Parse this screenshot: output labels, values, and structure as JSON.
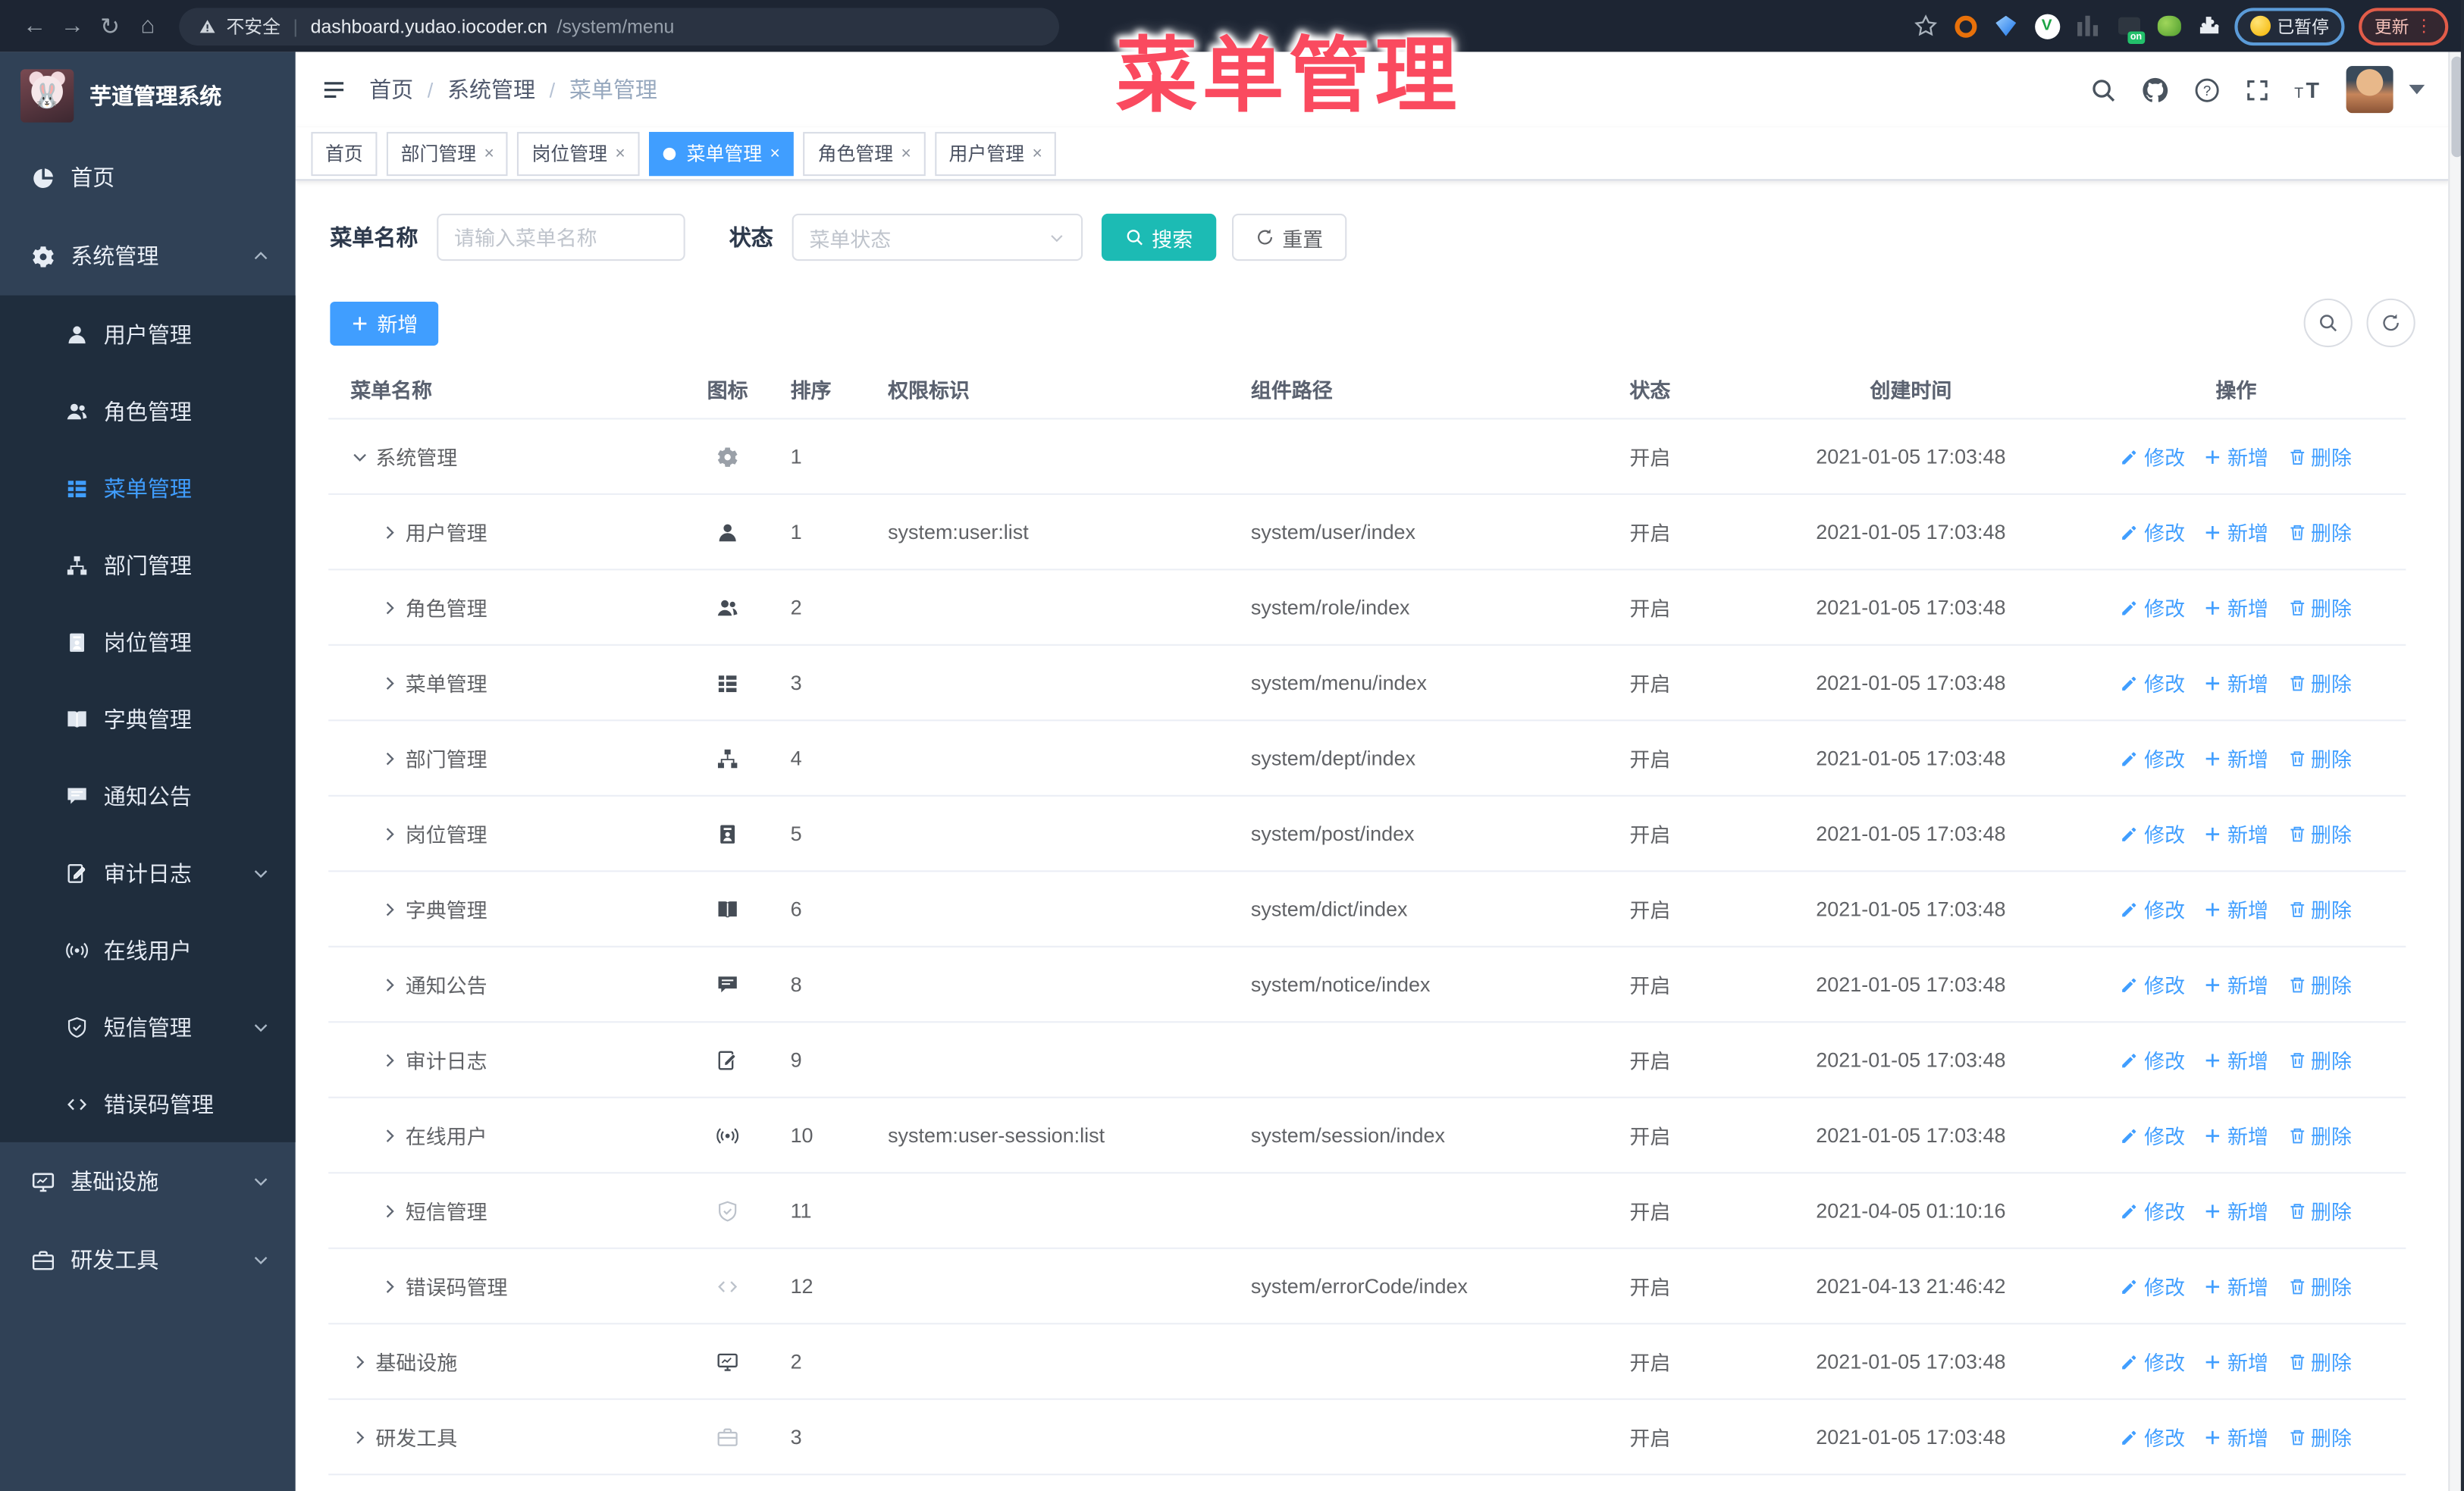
{
  "colors": {
    "accent": "#409eff",
    "teal": "#1cbbb4",
    "overlay": "#fa4a5f",
    "sidebar_bg": "#304156",
    "submenu_bg": "#1f2d3d",
    "chrome_bg": "#1d2533"
  },
  "overlay_title": "菜单管理",
  "browser": {
    "security_label": "不安全",
    "url_domain": "dashboard.yudao.iocoder.cn",
    "url_path": "/system/menu",
    "nav_icons": [
      "back",
      "forward",
      "reload",
      "home"
    ],
    "extension_icons": [
      "bookmark-star",
      "ext-ring",
      "ext-gem",
      "ext-check",
      "ext-columns",
      "ext-tag-on",
      "ext-frog",
      "ext-puzzle"
    ],
    "paused_badge": "已暂停",
    "update_button": "更新",
    "kebab": "⋮"
  },
  "sidebar": {
    "logo_title": "芋道管理系统",
    "items": [
      {
        "icon": "dashboard",
        "label": "首页"
      },
      {
        "icon": "gear",
        "label": "系统管理",
        "arrow": "up",
        "children": [
          {
            "icon": "user",
            "label": "用户管理"
          },
          {
            "icon": "users",
            "label": "角色管理"
          },
          {
            "icon": "tree",
            "label": "菜单管理",
            "active": true
          },
          {
            "icon": "org",
            "label": "部门管理"
          },
          {
            "icon": "badge",
            "label": "岗位管理"
          },
          {
            "icon": "book",
            "label": "字典管理"
          },
          {
            "icon": "chat",
            "label": "通知公告"
          },
          {
            "icon": "edit",
            "label": "审计日志",
            "arrow": "down"
          },
          {
            "icon": "signal",
            "label": "在线用户"
          },
          {
            "icon": "shield",
            "label": "短信管理",
            "arrow": "down"
          },
          {
            "icon": "code",
            "label": "错误码管理"
          }
        ]
      },
      {
        "icon": "monitor",
        "label": "基础设施",
        "arrow": "down"
      },
      {
        "icon": "briefcase",
        "label": "研发工具",
        "arrow": "down"
      }
    ]
  },
  "header": {
    "breadcrumb": [
      "首页",
      "系统管理",
      "菜单管理"
    ],
    "right_icons": [
      "search",
      "github",
      "question",
      "fullscreen",
      "fontsize",
      "avatar",
      "caret-down"
    ]
  },
  "tabs": [
    {
      "label": "首页",
      "closable": false,
      "active": false
    },
    {
      "label": "部门管理",
      "closable": true,
      "active": false
    },
    {
      "label": "岗位管理",
      "closable": true,
      "active": false
    },
    {
      "label": "菜单管理",
      "closable": true,
      "active": true
    },
    {
      "label": "角色管理",
      "closable": true,
      "active": false
    },
    {
      "label": "用户管理",
      "closable": true,
      "active": false
    }
  ],
  "filters": {
    "name_label": "菜单名称",
    "name_placeholder": "请输入菜单名称",
    "name_value": "",
    "status_label": "状态",
    "status_placeholder": "菜单状态",
    "search_label": "搜索",
    "reset_label": "重置"
  },
  "toolbar": {
    "add_label": "新增"
  },
  "table": {
    "columns": [
      "菜单名称",
      "图标",
      "排序",
      "权限标识",
      "组件路径",
      "状态",
      "创建时间",
      "操作"
    ],
    "op_labels": {
      "edit": "修改",
      "add": "新增",
      "delete": "删除"
    },
    "rows": [
      {
        "name": "系统管理",
        "caret": "down",
        "child": false,
        "icon": "gear",
        "tone": "mid",
        "sort": "1",
        "perm": "",
        "path": "",
        "status": "开启",
        "time": "2021-01-05 17:03:48"
      },
      {
        "name": "用户管理",
        "caret": "right",
        "child": true,
        "icon": "user",
        "tone": "dark",
        "sort": "1",
        "perm": "system:user:list",
        "path": "system/user/index",
        "status": "开启",
        "time": "2021-01-05 17:03:48"
      },
      {
        "name": "角色管理",
        "caret": "right",
        "child": true,
        "icon": "users",
        "tone": "dark",
        "sort": "2",
        "perm": "",
        "path": "system/role/index",
        "status": "开启",
        "time": "2021-01-05 17:03:48"
      },
      {
        "name": "菜单管理",
        "caret": "right",
        "child": true,
        "icon": "tree",
        "tone": "dark",
        "sort": "3",
        "perm": "",
        "path": "system/menu/index",
        "status": "开启",
        "time": "2021-01-05 17:03:48"
      },
      {
        "name": "部门管理",
        "caret": "right",
        "child": true,
        "icon": "org",
        "tone": "dark",
        "sort": "4",
        "perm": "",
        "path": "system/dept/index",
        "status": "开启",
        "time": "2021-01-05 17:03:48"
      },
      {
        "name": "岗位管理",
        "caret": "right",
        "child": true,
        "icon": "badge",
        "tone": "dark",
        "sort": "5",
        "perm": "",
        "path": "system/post/index",
        "status": "开启",
        "time": "2021-01-05 17:03:48"
      },
      {
        "name": "字典管理",
        "caret": "right",
        "child": true,
        "icon": "book",
        "tone": "dark",
        "sort": "6",
        "perm": "",
        "path": "system/dict/index",
        "status": "开启",
        "time": "2021-01-05 17:03:48"
      },
      {
        "name": "通知公告",
        "caret": "right",
        "child": true,
        "icon": "chat",
        "tone": "dark",
        "sort": "8",
        "perm": "",
        "path": "system/notice/index",
        "status": "开启",
        "time": "2021-01-05 17:03:48"
      },
      {
        "name": "审计日志",
        "caret": "right",
        "child": true,
        "icon": "edit",
        "tone": "dark",
        "sort": "9",
        "perm": "",
        "path": "",
        "status": "开启",
        "time": "2021-01-05 17:03:48"
      },
      {
        "name": "在线用户",
        "caret": "right",
        "child": true,
        "icon": "signal",
        "tone": "dark",
        "sort": "10",
        "perm": "system:user-session:list",
        "path": "system/session/index",
        "status": "开启",
        "time": "2021-01-05 17:03:48"
      },
      {
        "name": "短信管理",
        "caret": "right",
        "child": true,
        "icon": "shield",
        "tone": "light",
        "sort": "11",
        "perm": "",
        "path": "",
        "status": "开启",
        "time": "2021-04-05 01:10:16"
      },
      {
        "name": "错误码管理",
        "caret": "right",
        "child": true,
        "icon": "code",
        "tone": "light",
        "sort": "12",
        "perm": "",
        "path": "system/errorCode/index",
        "status": "开启",
        "time": "2021-04-13 21:46:42"
      },
      {
        "name": "基础设施",
        "caret": "right",
        "child": false,
        "icon": "monitor",
        "tone": "dark",
        "sort": "2",
        "perm": "",
        "path": "",
        "status": "开启",
        "time": "2021-01-05 17:03:48"
      },
      {
        "name": "研发工具",
        "caret": "right",
        "child": false,
        "icon": "briefcase",
        "tone": "light",
        "sort": "3",
        "perm": "",
        "path": "",
        "status": "开启",
        "time": "2021-01-05 17:03:48"
      }
    ]
  }
}
